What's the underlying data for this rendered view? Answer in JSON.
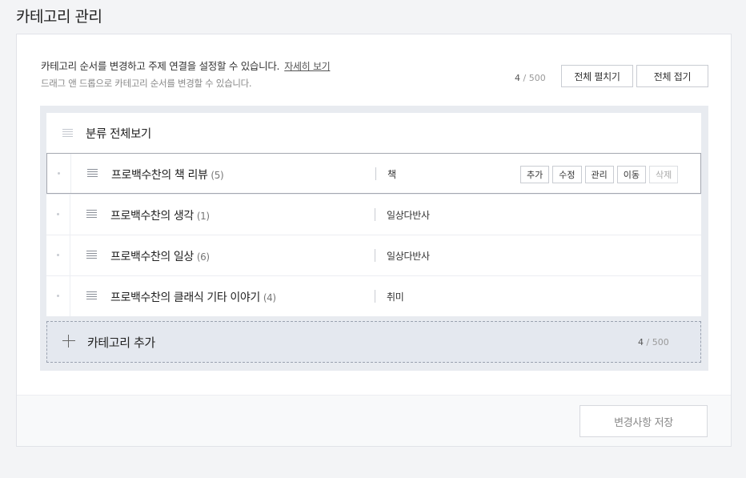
{
  "page": {
    "title": "카테고리 관리"
  },
  "intro": {
    "main": "카테고리 순서를 변경하고 주제 연결을 설정할 수 있습니다.",
    "more_link": "자세히 보기",
    "sub": "드래그 앤 드롭으로 카테고리 순서를 변경할 수 있습니다."
  },
  "counter": {
    "current": "4",
    "max": "/ 500"
  },
  "toolbar": {
    "expand_all": "전체 펼치기",
    "collapse_all": "전체 접기"
  },
  "tree": {
    "root_label": "분류 전체보기",
    "categories": [
      {
        "name": "프로백수찬의 책 리뷰",
        "count": "(5)",
        "topic": "책"
      },
      {
        "name": "프로백수찬의 생각",
        "count": "(1)",
        "topic": "일상다반사"
      },
      {
        "name": "프로백수찬의 일상",
        "count": "(6)",
        "topic": "일상다반사"
      },
      {
        "name": "프로백수찬의 클래식 기타 이야기",
        "count": "(4)",
        "topic": "취미"
      }
    ],
    "actions": {
      "add": "추가",
      "edit": "수정",
      "manage": "관리",
      "move": "이동",
      "delete": "삭제"
    }
  },
  "add_category": {
    "label": "카테고리 추가",
    "count": "4",
    "max": "/ 500"
  },
  "footer": {
    "save_label": "변경사항 저장"
  }
}
